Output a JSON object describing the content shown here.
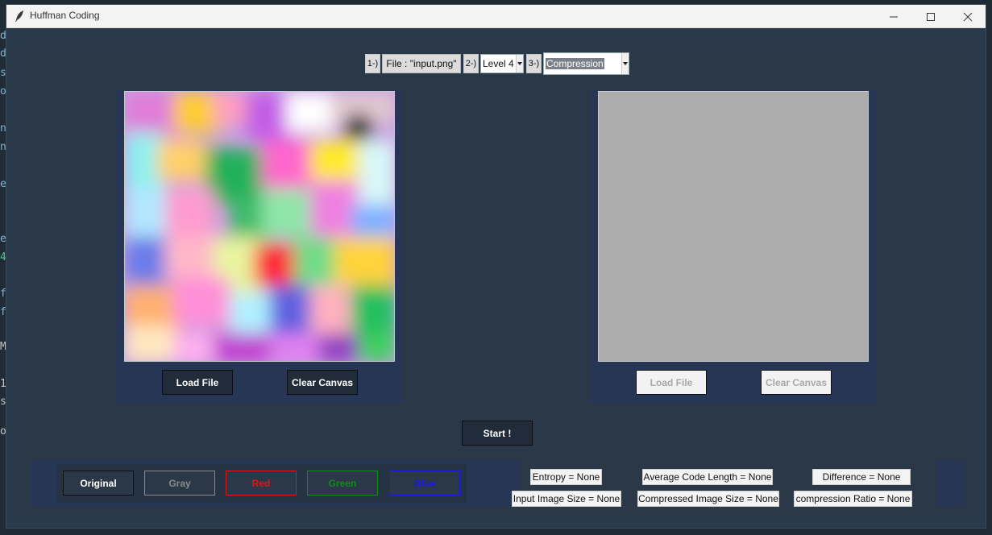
{
  "window": {
    "title": "Huffman Coding"
  },
  "background_text": [
    "d",
    "d",
    "s",
    "o",
    "n",
    "n",
    "e",
    "e",
    "4",
    "f",
    "f",
    "M",
    "1",
    "s",
    "o"
  ],
  "toolbar": {
    "step1": "1-)",
    "file_label": "File : \"input.png\"",
    "step2": "2-)",
    "level_value": "Level 4",
    "step3": "3-)",
    "mode_value": "Compression"
  },
  "left_panel": {
    "load_label": "Load File",
    "clear_label": "Clear Canvas"
  },
  "right_panel": {
    "load_label": "Load File",
    "clear_label": "Clear Canvas"
  },
  "start_label": "Start !",
  "channels": {
    "original": {
      "label": "Original",
      "color": "#ffffff"
    },
    "gray": {
      "label": "Gray",
      "color": "#8a8a8a"
    },
    "red": {
      "label": "Red",
      "color": "#e0151a"
    },
    "green": {
      "label": "Green",
      "color": "#138a1e"
    },
    "blue": {
      "label": "Blue",
      "color": "#1a1ae6"
    }
  },
  "stats": {
    "entropy": "Entropy = None",
    "avg_code_length": "Average Code Length = None",
    "difference": "Difference = None",
    "input_size": "Input Image Size = None",
    "compressed_size": "Compressed Image Size = None",
    "ratio": "compression Ratio = None"
  }
}
